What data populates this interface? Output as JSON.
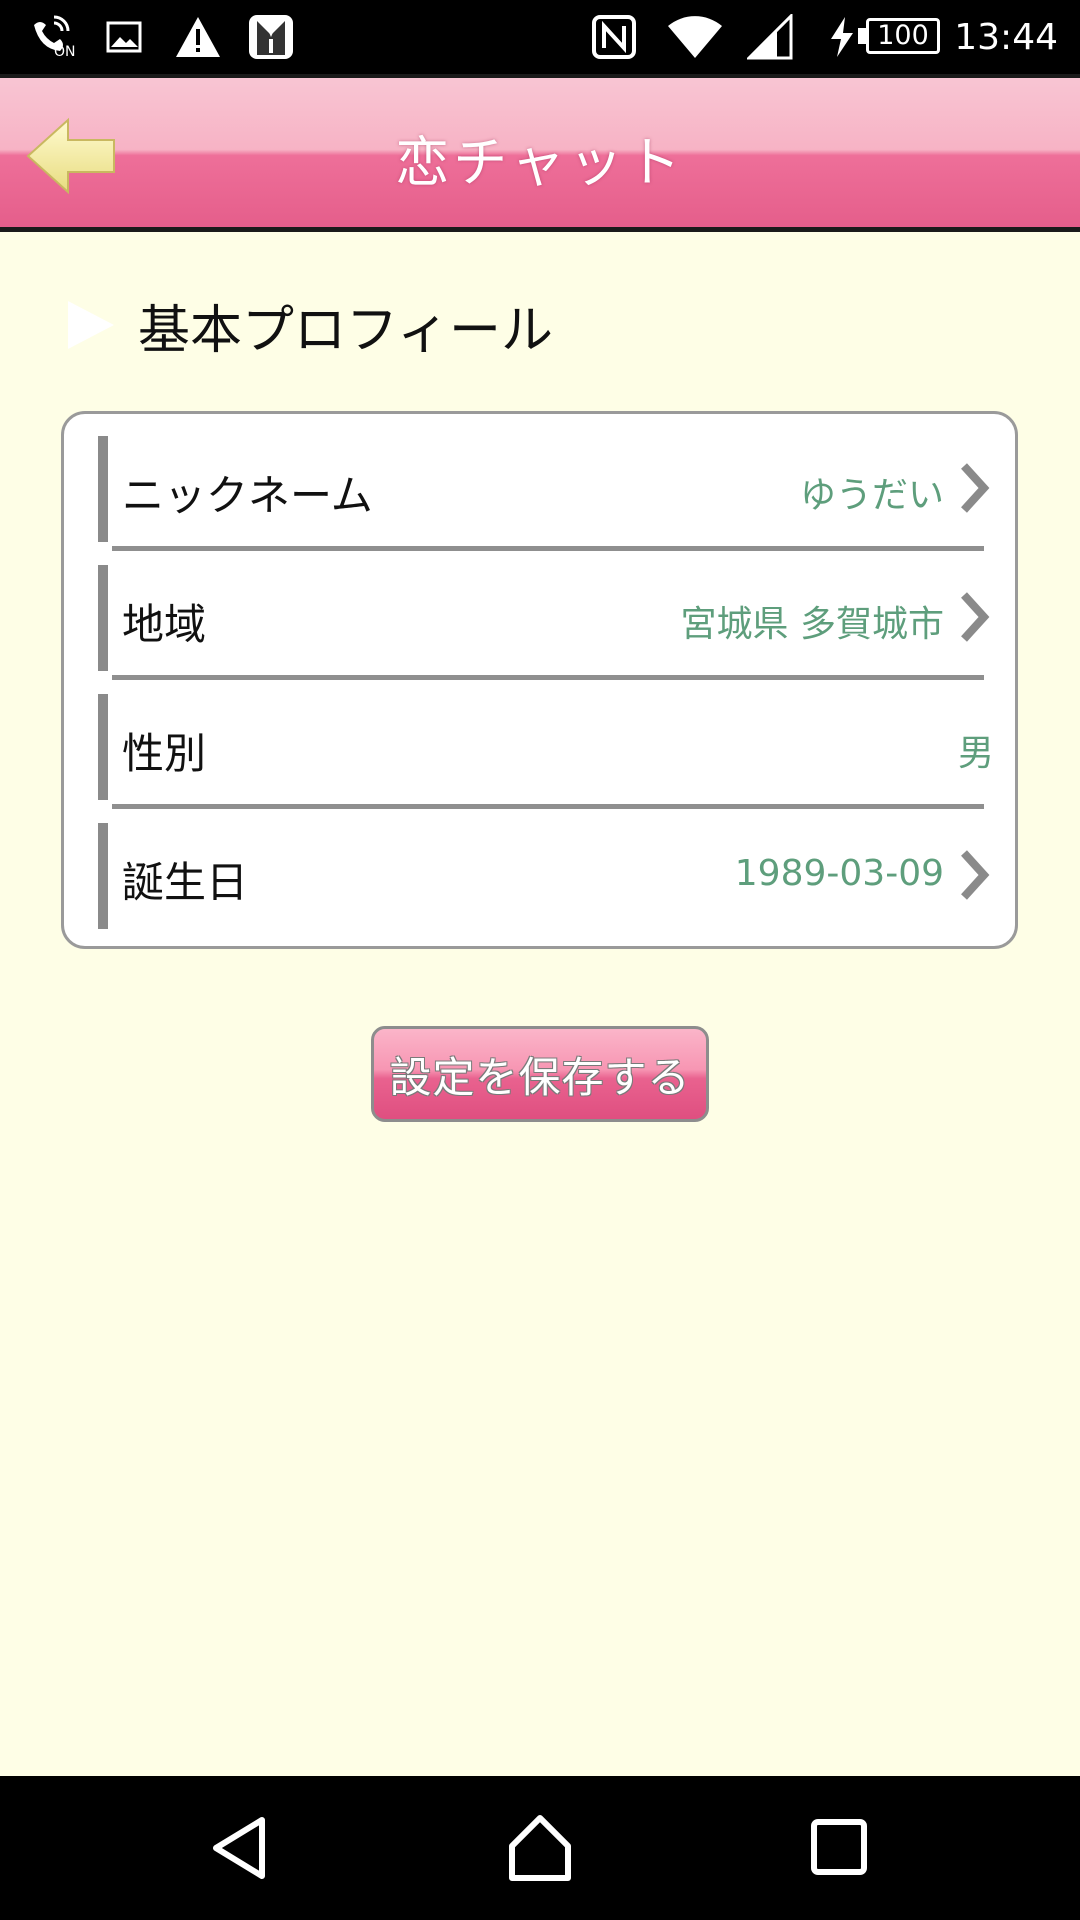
{
  "status_bar": {
    "time": "13:44",
    "battery": "100",
    "icons": [
      "nfc-on-icon",
      "image-icon",
      "warning-icon",
      "tuxedo-icon",
      "nfc-icon",
      "wifi-icon",
      "signal-icon",
      "charging-icon",
      "battery-icon"
    ],
    "on_label": "ON"
  },
  "header": {
    "title": "恋チャット",
    "back_icon": "arrow-left-icon"
  },
  "section": {
    "title": "基本プロフィール"
  },
  "profile": {
    "rows": [
      {
        "label": "ニックネーム",
        "value": "ゆうだい",
        "has_chevron": true
      },
      {
        "label": "地域",
        "value": "宮城県 多賀城市",
        "has_chevron": true
      },
      {
        "label": "性別",
        "value": "男",
        "has_chevron": false
      },
      {
        "label": "誕生日",
        "value": "1989-03-09",
        "has_chevron": true
      }
    ]
  },
  "actions": {
    "save_label": "設定を保存する"
  },
  "colors": {
    "background": "#fefee6",
    "header_pink": "#ee6f99",
    "value_green": "#5e9e7c",
    "button_pink": "#e9628f"
  },
  "nav": {
    "back": "nav-back-icon",
    "home": "nav-home-icon",
    "recents": "nav-recents-icon"
  }
}
